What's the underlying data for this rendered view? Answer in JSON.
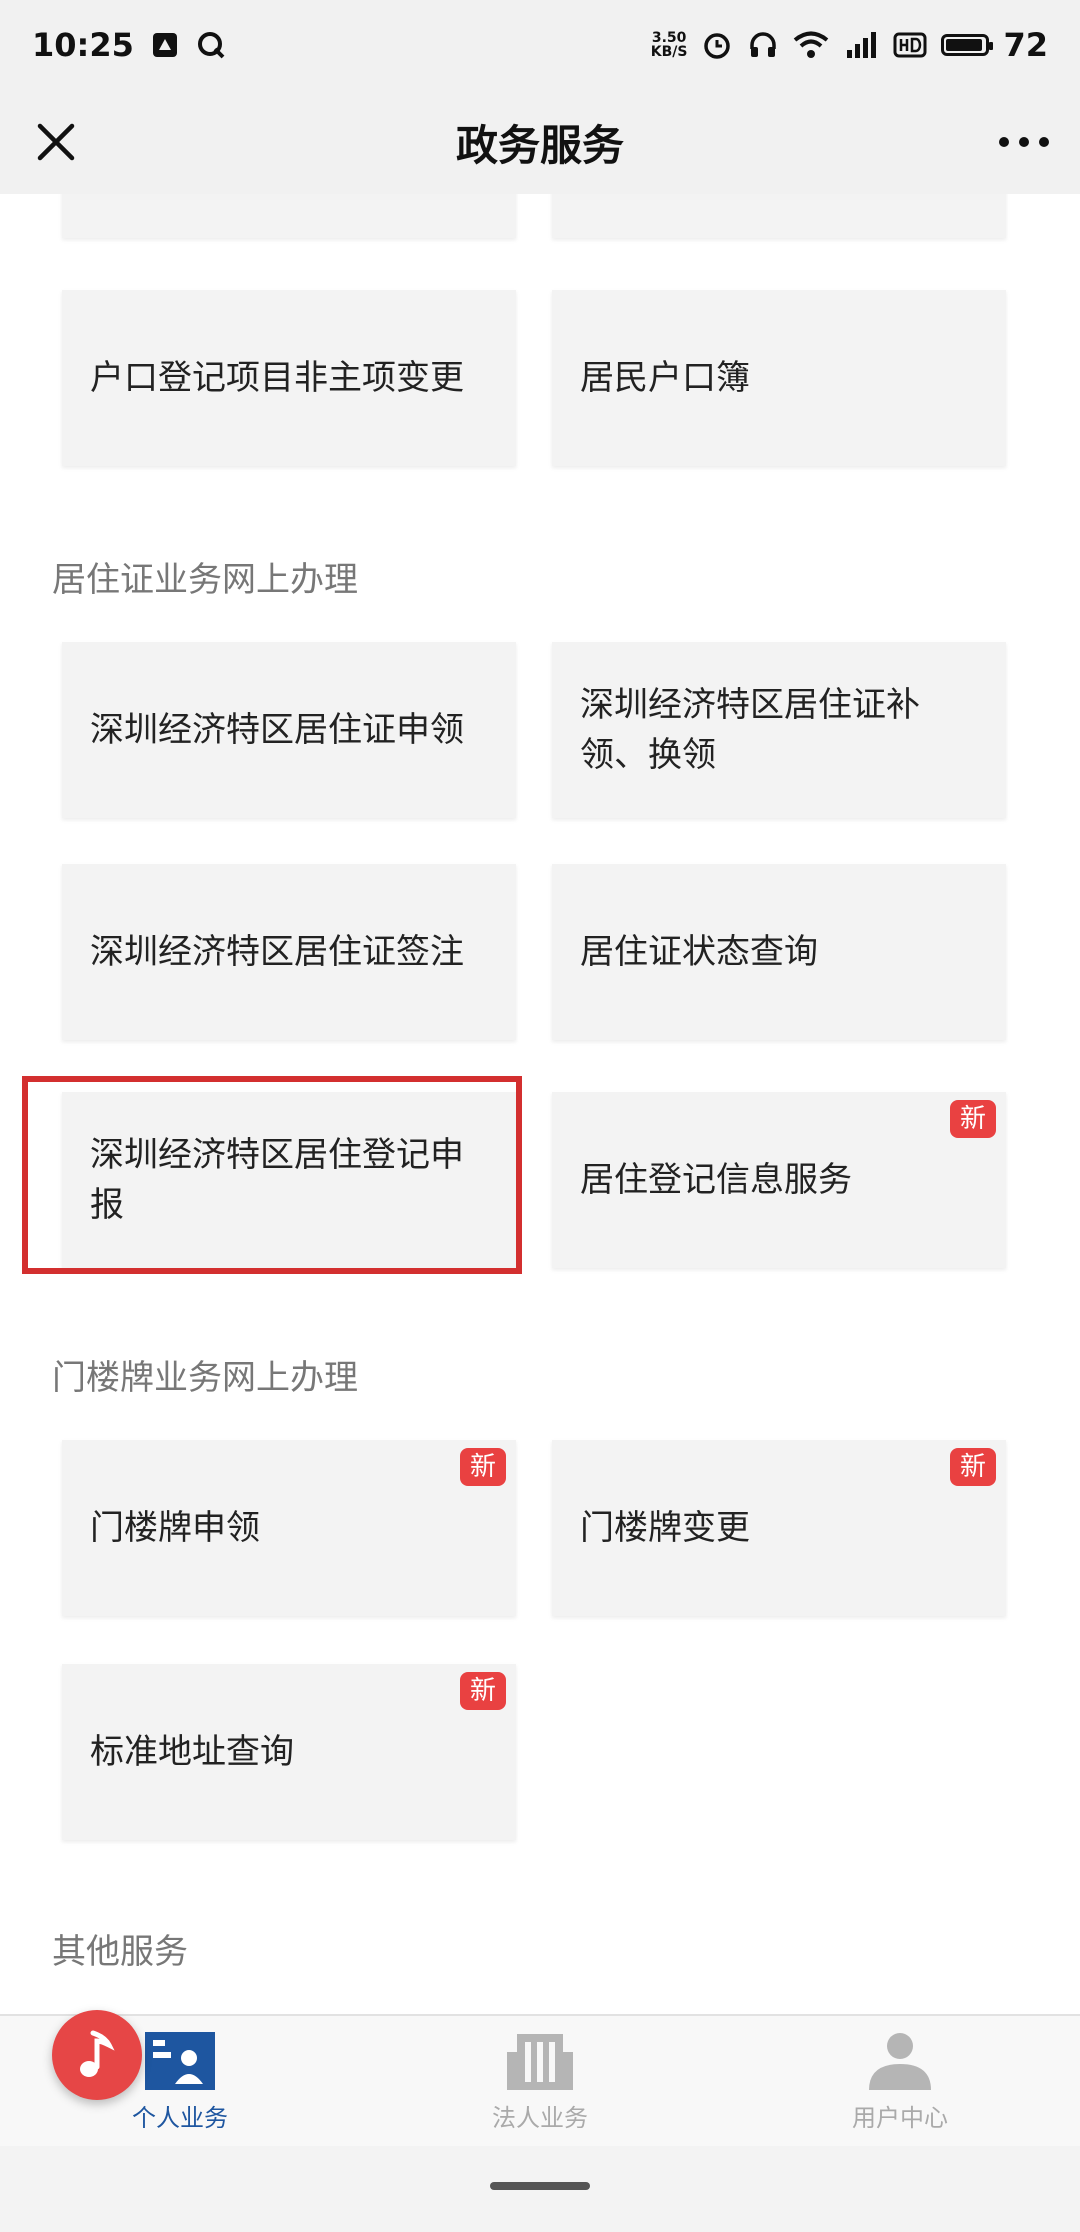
{
  "status_bar": {
    "time": "10:25",
    "net_speed_value": "3.50",
    "net_speed_unit": "KB/S",
    "battery_level": "72"
  },
  "title_bar": {
    "title": "政务服务"
  },
  "sections": {
    "household": {
      "items": [
        "户口登记项目非主项变更",
        "居民户口簿"
      ]
    },
    "residence": {
      "title": "居住证业务网上办理",
      "items": [
        "深圳经济特区居住证申领",
        "深圳经济特区居住证补领、换领",
        "深圳经济特区居住证签注",
        "居住证状态查询",
        "深圳经济特区居住登记申报",
        "居住登记信息服务"
      ]
    },
    "doorplate": {
      "title": "门楼牌业务网上办理",
      "items": [
        "门楼牌申领",
        "门楼牌变更",
        "标准地址查询"
      ]
    },
    "other": {
      "title": "其他服务"
    }
  },
  "badge_new": "新",
  "tabs": [
    "个人业务",
    "法人业务",
    "用户中心"
  ],
  "colors": {
    "accent": "#1e56a0",
    "badge": "#e94141",
    "highlight": "#d32f2f"
  }
}
